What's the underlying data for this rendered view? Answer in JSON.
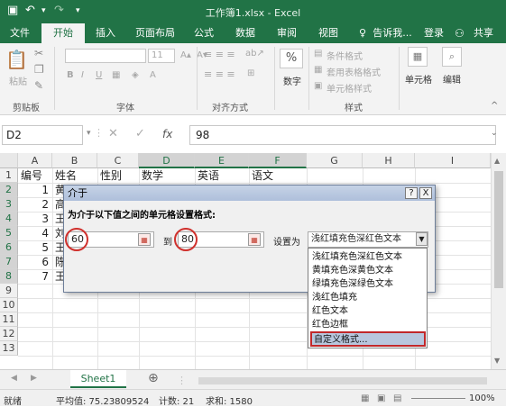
{
  "window": {
    "title": "工作簿1.xlsx - Excel"
  },
  "quick_access": {
    "save_icon": "save-icon",
    "undo_icon": "undo-icon",
    "redo_icon": "redo-icon"
  },
  "tabs": [
    "文件",
    "开始",
    "插入",
    "页面布局",
    "公式",
    "数据",
    "审阅",
    "视图"
  ],
  "active_tab": "开始",
  "tell_me": "告诉我...",
  "login": "登录",
  "share": "共享",
  "ribbon": {
    "clipboard": {
      "paste_label": "粘贴",
      "group_label": "剪贴板"
    },
    "font": {
      "size_value": "11",
      "group_label": "字体",
      "bold": "B",
      "italic": "I",
      "underline": "U"
    },
    "alignment": {
      "group_label": "对齐方式"
    },
    "number": {
      "percent": "%",
      "label": "数字"
    },
    "styles": {
      "conditional": "条件格式",
      "table_format": "套用表格格式",
      "cell_styles": "单元格样式",
      "group_label": "样式"
    },
    "cells": {
      "label": "单元格"
    },
    "editing": {
      "label": "编辑"
    }
  },
  "formula_bar": {
    "name_box": "D2",
    "fx": "fx",
    "value": "98"
  },
  "columns": [
    "A",
    "B",
    "C",
    "D",
    "E",
    "F",
    "G",
    "H",
    "I"
  ],
  "rows": [
    "1",
    "2",
    "3",
    "4",
    "5",
    "6",
    "7",
    "8",
    "9",
    "10",
    "11",
    "12",
    "13"
  ],
  "sheet_cells": {
    "header": [
      "编号",
      "姓名",
      "性别",
      "数学",
      "英语",
      "语文"
    ],
    "ids": [
      "1",
      "2",
      "3",
      "4",
      "5",
      "6",
      "7"
    ],
    "names_partial": [
      "黄",
      "高",
      "王",
      "刘",
      "王",
      "陈",
      "王"
    ]
  },
  "dialog": {
    "title": "介于",
    "help": "?",
    "close": "X",
    "prompt": "为介于以下值之间的单元格设置格式:",
    "min_value": "60",
    "to_label": "到",
    "max_value": "80",
    "set_as_label": "设置为",
    "format_selected": "浅红填充色深红色文本",
    "options": [
      "浅红填充色深红色文本",
      "黄填充色深黄色文本",
      "绿填充色深绿色文本",
      "浅红色填充",
      "红色文本",
      "红色边框",
      "自定义格式..."
    ],
    "highlighted_option": "自定义格式..."
  },
  "sheet_tabs": {
    "active": "Sheet1",
    "add": "⊕"
  },
  "status_bar": {
    "mode": "就绪",
    "average": "平均值: 75.23809524",
    "count": "计数: 21",
    "sum": "求和: 1580",
    "zoom": "100%"
  },
  "colors": {
    "accent": "#217346",
    "highlight_border": "#c0282a"
  }
}
